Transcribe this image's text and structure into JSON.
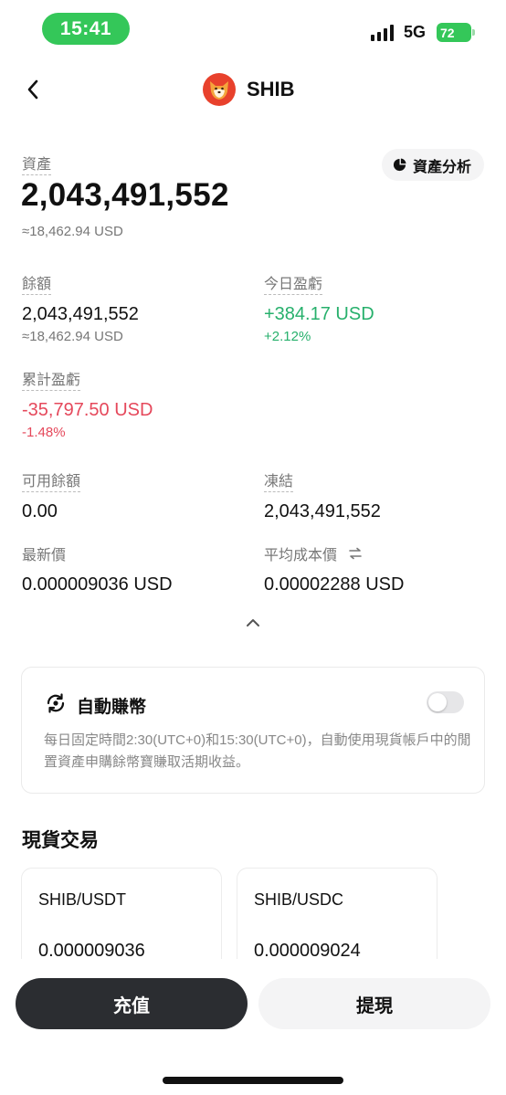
{
  "status_bar": {
    "time": "15:41",
    "network": "5G",
    "battery": "72"
  },
  "header": {
    "title": "SHIB",
    "coin_icon": "shiba-inu-icon"
  },
  "asset": {
    "label": "資產",
    "analysis_button": "資產分析",
    "value": "2,043,491,552",
    "usd": "≈18,462.94 USD"
  },
  "balance": {
    "label": "餘額",
    "value": "2,043,491,552",
    "usd": "≈18,462.94 USD"
  },
  "today_pnl": {
    "label": "今日盈虧",
    "value": "+384.17 USD",
    "percent": "+2.12%"
  },
  "total_pnl": {
    "label": "累計盈虧",
    "value": "-35,797.50 USD",
    "percent": "-1.48%"
  },
  "available": {
    "label": "可用餘額",
    "value": "0.00"
  },
  "frozen": {
    "label": "凍結",
    "value": "2,043,491,552"
  },
  "latest_price": {
    "label": "最新價",
    "value": "0.000009036 USD"
  },
  "avg_cost": {
    "label": "平均成本價",
    "value": "0.00002288 USD"
  },
  "auto_earn": {
    "title": "自動賺幣",
    "enabled": false,
    "description": "每日固定時間2:30(UTC+0)和15:30(UTC+0)，自動使用現貨帳戶中的閒置資產申購餘幣寶賺取活期收益。"
  },
  "spot": {
    "title": "現貨交易",
    "pairs": [
      {
        "name": "SHIB/USDT",
        "price": "0.000009036"
      },
      {
        "name": "SHIB/USDC",
        "price": "0.000009024"
      }
    ]
  },
  "actions": {
    "deposit": "充值",
    "withdraw": "提現"
  },
  "colors": {
    "positive": "#27b06c",
    "negative": "#e5485b",
    "status_green": "#34c759",
    "primary_button": "#2b2d31"
  }
}
